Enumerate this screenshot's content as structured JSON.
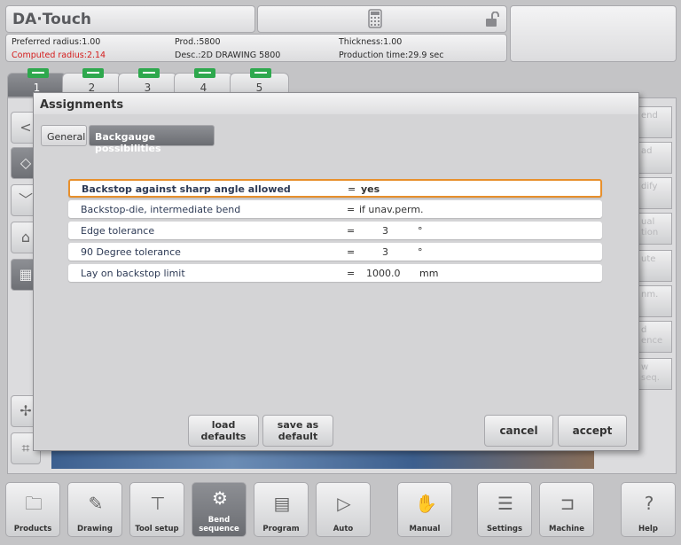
{
  "app": {
    "brand": "DA·Touch"
  },
  "header": {
    "preferred_radius": "Preferred radius:1.00",
    "computed_radius": "Computed radius:2.14",
    "prod": "Prod.:5800",
    "desc": "Desc.:2D DRAWING 5800",
    "thickness": "Thickness:1.00",
    "production_time": "Production time:29.9 sec"
  },
  "tabs": [
    {
      "label": "1"
    },
    {
      "label": "2"
    },
    {
      "label": "3"
    },
    {
      "label": "4"
    },
    {
      "label": "5"
    }
  ],
  "right_buttons": [
    "end",
    "ad",
    "dify",
    "ual\ntion",
    "ute",
    "nm.",
    "d\nence",
    "w\nseq."
  ],
  "dialog": {
    "title": "Assignments",
    "tab_general": "General",
    "tab_backgauge": "Backgauge possibilities",
    "rows": [
      {
        "label": "Backstop against sharp angle allowed",
        "eq": "=",
        "value": "yes",
        "unit": ""
      },
      {
        "label": "Backstop-die, intermediate bend",
        "eq": "=",
        "value": "if unav.perm.",
        "unit": ""
      },
      {
        "label": "Edge tolerance",
        "eq": "=",
        "value": "3",
        "unit": "°"
      },
      {
        "label": "90 Degree tolerance",
        "eq": "=",
        "value": "3",
        "unit": "°"
      },
      {
        "label": "Lay on backstop limit",
        "eq": "=",
        "value": "1000.0",
        "unit": "mm"
      }
    ],
    "load_defaults": "load\ndefaults",
    "save_as_default": "save as\ndefault",
    "cancel": "cancel",
    "accept": "accept"
  },
  "bottom_nav": [
    {
      "label": "Products",
      "icon": "folder-icon"
    },
    {
      "label": "Drawing",
      "icon": "pencil-icon"
    },
    {
      "label": "Tool setup",
      "icon": "tools-icon"
    },
    {
      "label": "Bend\nsequence",
      "icon": "bend-icon"
    },
    {
      "label": "Program",
      "icon": "pages-icon"
    },
    {
      "label": "Auto",
      "icon": "play-icon"
    },
    {
      "label": "Manual",
      "icon": "hand-icon"
    },
    {
      "label": "Settings",
      "icon": "list-icon"
    },
    {
      "label": "Machine",
      "icon": "machine-icon"
    },
    {
      "label": "Help",
      "icon": "help-icon"
    }
  ]
}
